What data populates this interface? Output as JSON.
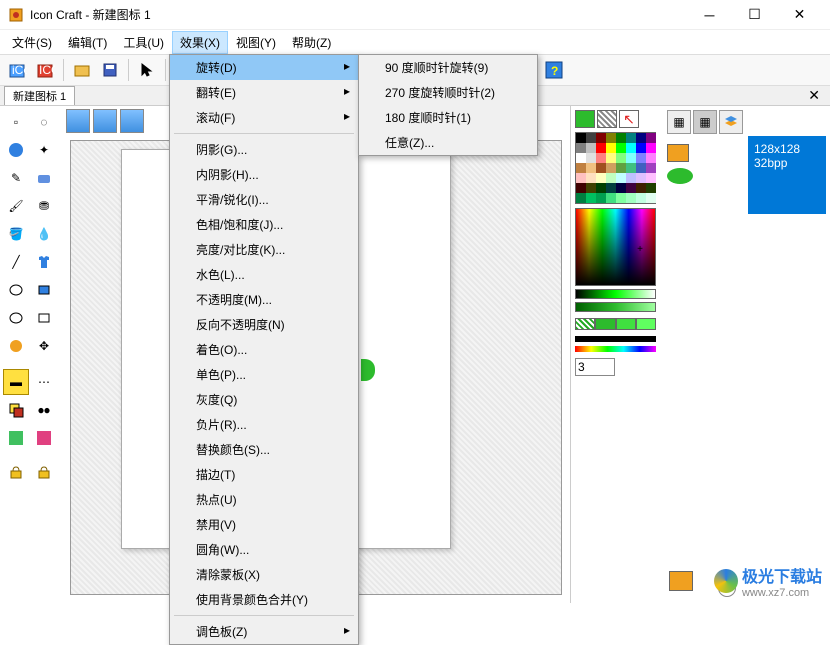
{
  "title": "Icon Craft - 新建图标 1",
  "menu": {
    "file": "文件(S)",
    "edit": "编辑(T)",
    "tools": "工具(U)",
    "effects": "效果(X)",
    "view": "视图(Y)",
    "help": "帮助(Z)"
  },
  "tab": {
    "label": "新建图标 1"
  },
  "dropdown": {
    "rotate": "旋转(D)",
    "flip": "翻转(E)",
    "scroll": "滚动(F)",
    "shadow": "阴影(G)...",
    "inner_shadow": "内阴影(H)...",
    "smooth": "平滑/锐化(I)...",
    "hue": "色相/饱和度(J)...",
    "brightness": "亮度/对比度(K)...",
    "aqua": "水色(L)...",
    "opacity": "不透明度(M)...",
    "inv_opacity": "反向不透明度(N)",
    "colorize": "着色(O)...",
    "mono": "单色(P)...",
    "gray": "灰度(Q)",
    "negative": "负片(R)...",
    "replace": "替换颜色(S)...",
    "stroke": "描边(T)",
    "hotspot": "热点(U)",
    "disable": "禁用(V)",
    "round": "圆角(W)...",
    "clear_mask": "清除蒙板(X)",
    "merge_bg": "使用背景颜色合并(Y)",
    "palette": "调色板(Z)"
  },
  "submenu": {
    "r90": "90 度顺时针旋转(9)",
    "r270": "270 度旋转顺时针(2)",
    "r180": "180 度顺时针(1)",
    "custom": "任意(Z)..."
  },
  "info": {
    "size": "128x128",
    "depth": "32bpp"
  },
  "spin_value": "3",
  "watermark": {
    "brand": "极光下载站",
    "url": "www.xz7.com"
  },
  "palette": [
    [
      "#000000",
      "#404040",
      "#800000",
      "#808000",
      "#008000",
      "#008080",
      "#000080",
      "#800080"
    ],
    [
      "#808080",
      "#c0c0c0",
      "#ff0000",
      "#ffff00",
      "#00ff00",
      "#00ffff",
      "#0000ff",
      "#ff00ff"
    ],
    [
      "#ffffff",
      "#e0e0e0",
      "#ff8080",
      "#ffff80",
      "#80ff80",
      "#80ffff",
      "#8080ff",
      "#ff80ff"
    ],
    [
      "#c08040",
      "#f0c080",
      "#a05020",
      "#d0a060",
      "#60a040",
      "#40c080",
      "#4060c0",
      "#a040c0"
    ],
    [
      "#ffc0c0",
      "#ffe0c0",
      "#ffffc0",
      "#c0ffc0",
      "#c0ffff",
      "#c0c0ff",
      "#e0c0ff",
      "#ffc0ff"
    ],
    [
      "#400000",
      "#404000",
      "#004000",
      "#004040",
      "#000040",
      "#400040",
      "#402000",
      "#204000"
    ],
    [
      "#008040",
      "#00c060",
      "#00a050",
      "#40e080",
      "#80ffa0",
      "#a0ffc0",
      "#c0ffe0",
      "#e0fff0"
    ]
  ]
}
